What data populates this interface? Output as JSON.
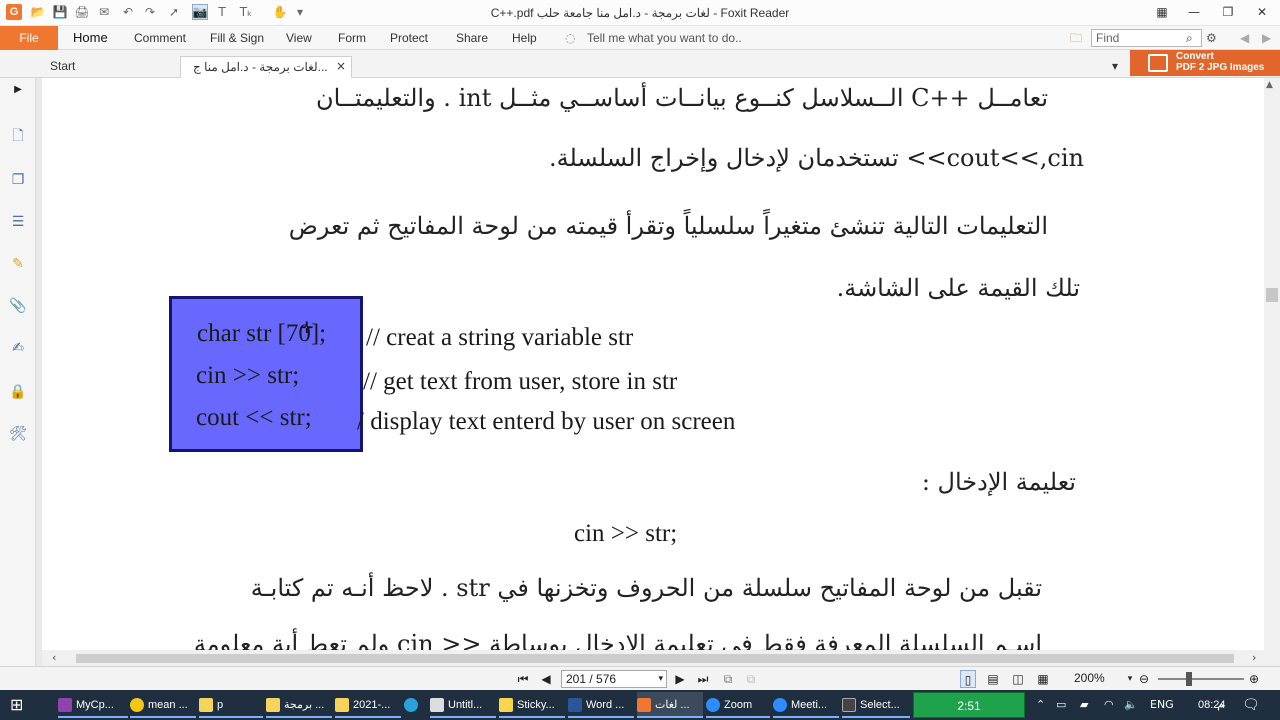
{
  "window": {
    "title": "C++.pdf لغات برمجة - د.امل منا جامعة حلب - Foxit Reader"
  },
  "ribbon": {
    "file": "File",
    "tabs": [
      "Home",
      "Comment",
      "Fill & Sign",
      "View",
      "Form",
      "Protect",
      "Share",
      "Help"
    ],
    "tell_me": "Tell me what you want to do..",
    "find_placeholder": "Find"
  },
  "doc_tabs": {
    "start": "Start",
    "current": "لغات برمجة - د.امل منا ج...",
    "close_glyph": "×"
  },
  "convert": {
    "line1": "Convert",
    "line2": "PDF 2 JPG Images"
  },
  "page": {
    "lines": [
      "تعامــل ++C الــسلاسل كنــوع بيانــات أساســي مثــل int . والتعليمتــان",
      "cout<<,cin>> تستخدمان لإدخال وإخراج السلسلة.",
      "التعليمات التالية تنشئ متغيراً سلسلياً وتقرأ قيمته من لوحة المفاتيح ثم تعرض",
      "تلك القيمة على الشاشة.",
      "تعليمة الإدخال :",
      "تقبل من لوحة المفاتيح سلسلة من الحروف وتخزنها في str . لاحظ أنـه تم كتابـة",
      "اسـم السلسلة المعرفة فقط في تعليمة الإدخال بوساطة << cin ولم تعط أية معلومة"
    ],
    "code": [
      {
        "stmt": "char str [70];",
        "comment": "//  creat a string variable str"
      },
      {
        "stmt": "cin >> str;",
        "comment": "//   get text from user, store in str"
      },
      {
        "stmt": "cout << str;",
        "comment": "/    display text enterd by user on screen"
      }
    ],
    "cin_line": "cin >> str;"
  },
  "status": {
    "page_indicator": "201 / 576",
    "zoom": "200%"
  },
  "taskbar": {
    "items": [
      {
        "label": "MyCp...",
        "color": "#8e44ad"
      },
      {
        "label": "mean ...",
        "color": "#f2c811"
      },
      {
        "label": "p",
        "color": "#f6d35a"
      },
      {
        "label": "برمجة ...",
        "color": "#f6d35a"
      },
      {
        "label": "2021-...",
        "color": "#f6d35a"
      },
      {
        "label": "",
        "color": "#2aa1da"
      },
      {
        "label": "Untitl...",
        "color": "#dddddd"
      },
      {
        "label": "Sticky...",
        "color": "#f7d64d"
      },
      {
        "label": "Word ...",
        "color": "#2b579a"
      },
      {
        "label": "لغات ...",
        "color": "#f0772f"
      },
      {
        "label": "Zoom",
        "color": "#2d8cff"
      },
      {
        "label": "Meeti...",
        "color": "#2d8cff"
      },
      {
        "label": "Select...",
        "color": "#444444"
      }
    ],
    "timer": "2:51",
    "lang": "ENG",
    "time": "08:24",
    "ampm": "م"
  },
  "colors": {
    "accent": "#f0772f",
    "highlight": "#6868ff",
    "highlight_border": "#141472"
  }
}
